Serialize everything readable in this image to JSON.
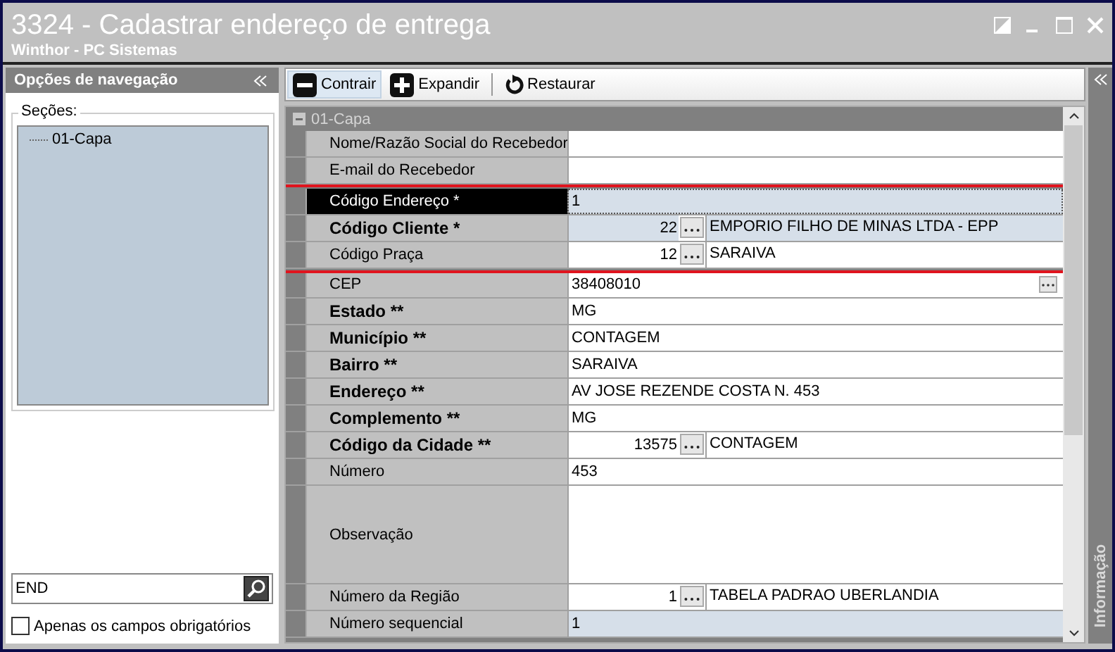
{
  "window": {
    "title": "3324 - Cadastrar endereço de entrega",
    "subtitle": "Winthor - PC Sistemas"
  },
  "navigation": {
    "title": "Opções de navegação",
    "sections_label": "Seções:",
    "sections": [
      {
        "label": "01-Capa",
        "selected": false
      }
    ],
    "search": {
      "value": "END"
    },
    "required_only": {
      "label": "Apenas os campos obrigatórios",
      "checked": false
    }
  },
  "toolbar": [
    {
      "label": "Contrair",
      "kind": "collapse",
      "selected": true
    },
    {
      "label": "Expandir",
      "kind": "expand",
      "selected": false
    },
    {
      "label": "Restaurar",
      "kind": "restore",
      "selected": false
    }
  ],
  "grid": {
    "group": "01-Capa",
    "expanded": true,
    "rows": [
      {
        "label": "Nome/Razão Social do Recebedor",
        "kind": "text",
        "value": "",
        "bold": false,
        "selected": false,
        "shaded": false,
        "marked": false
      },
      {
        "label": "E-mail do Recebedor",
        "kind": "text",
        "value": "",
        "bold": false,
        "selected": false,
        "shaded": false,
        "marked": false
      },
      {
        "label": "Código Endereço *",
        "kind": "text",
        "value": "1",
        "bold": false,
        "selected": true,
        "shaded": true,
        "marked": true
      },
      {
        "label": "Código Cliente  *",
        "kind": "lookup",
        "code": "22",
        "value": "EMPORIO FILHO DE MINAS LTDA - EPP",
        "bold": true,
        "selected": false,
        "shaded": true,
        "marked": true
      },
      {
        "label": "Código Praça",
        "kind": "lookup",
        "code": "12",
        "value": "SARAIVA",
        "bold": false,
        "selected": false,
        "shaded": false,
        "marked": true
      },
      {
        "label": "CEP",
        "kind": "button",
        "value": "38408010",
        "bold": false,
        "selected": false,
        "shaded": false,
        "marked": false
      },
      {
        "label": "Estado **",
        "kind": "text",
        "value": "MG",
        "bold": true,
        "selected": false,
        "shaded": false,
        "marked": false
      },
      {
        "label": "Município **",
        "kind": "text",
        "value": "CONTAGEM",
        "bold": true,
        "selected": false,
        "shaded": false,
        "marked": false
      },
      {
        "label": "Bairro **",
        "kind": "text",
        "value": "SARAIVA",
        "bold": true,
        "selected": false,
        "shaded": false,
        "marked": false
      },
      {
        "label": "Endereço **",
        "kind": "text",
        "value": "AV JOSE REZENDE COSTA N. 453",
        "bold": true,
        "selected": false,
        "shaded": false,
        "marked": false
      },
      {
        "label": "Complemento **",
        "kind": "text",
        "value": "MG",
        "bold": true,
        "selected": false,
        "shaded": false,
        "marked": false
      },
      {
        "label": "Código da Cidade **",
        "kind": "lookup",
        "code": "13575",
        "value": "CONTAGEM",
        "bold": true,
        "selected": false,
        "shaded": false,
        "marked": false
      },
      {
        "label": "Número",
        "kind": "text",
        "value": "453",
        "bold": false,
        "selected": false,
        "shaded": false,
        "marked": false
      },
      {
        "label": "Observação",
        "kind": "memo",
        "value": "",
        "bold": false,
        "selected": false,
        "shaded": false,
        "marked": false
      },
      {
        "label": "Número da Região",
        "kind": "lookup",
        "code": "1",
        "value": "TABELA PADRAO UBERLANDIA",
        "bold": false,
        "selected": false,
        "shaded": false,
        "marked": false
      },
      {
        "label": "Número sequencial",
        "kind": "text",
        "value": "1",
        "bold": false,
        "selected": false,
        "shaded": true,
        "marked": false
      }
    ]
  },
  "side_panel": {
    "label": "Informação"
  }
}
